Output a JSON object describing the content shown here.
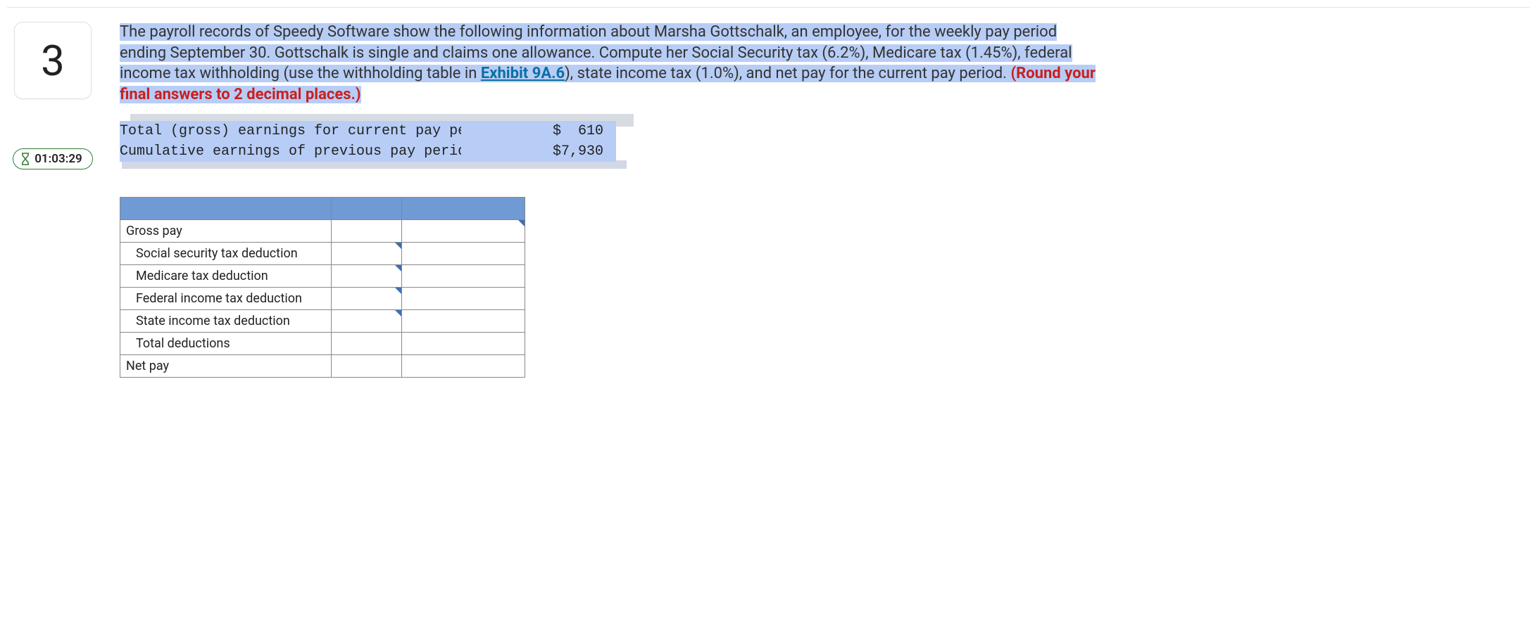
{
  "question": {
    "number": "3",
    "timer": "01:03:29",
    "text_part1": "The payroll records of Speedy Software show the following information about Marsha Gottschalk, an employee, for the weekly pay period ending September 30. Gottschalk is single and claims one allowance. Compute her Social Security tax (6.2%), Medicare tax (1.45%), federal income tax withholding (use the withholding table in ",
    "exhibit_label": "Exhibit 9A.6",
    "text_part2": "), state income tax (1.0%), and net pay for the current pay period. ",
    "rounding_note": "(Round your final answers to 2 decimal places.)"
  },
  "given": {
    "rows": [
      {
        "label": "Total (gross) earnings for current pay period",
        "value": "$  610"
      },
      {
        "label": "Cumulative earnings of previous pay periods",
        "value": "$7,930"
      }
    ]
  },
  "answer": {
    "rows": [
      {
        "label": "Gross pay",
        "indent": false,
        "mid_input": false,
        "right_input": true
      },
      {
        "label": "Social security tax deduction",
        "indent": true,
        "mid_input": true,
        "right_input": false
      },
      {
        "label": "Medicare tax deduction",
        "indent": true,
        "mid_input": true,
        "right_input": false
      },
      {
        "label": "Federal income tax deduction",
        "indent": true,
        "mid_input": true,
        "right_input": false
      },
      {
        "label": "State income tax deduction",
        "indent": true,
        "mid_input": true,
        "right_input": false
      },
      {
        "label": "Total deductions",
        "indent": true,
        "mid_input": false,
        "right_input": false
      },
      {
        "label": "Net pay",
        "indent": false,
        "mid_input": false,
        "right_input": false
      }
    ]
  }
}
